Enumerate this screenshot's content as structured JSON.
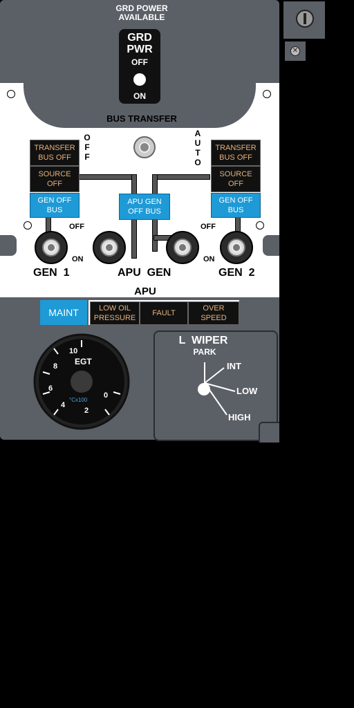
{
  "grd": {
    "available_line1": "GRD POWER",
    "available_line2": "AVAILABLE",
    "switch_line1": "GRD",
    "switch_line2": "PWR",
    "off": "OFF",
    "on": "ON"
  },
  "bus_transfer": {
    "label": "BUS TRANSFER",
    "off_letters": "OFF",
    "auto_letters": "AUTO"
  },
  "left_lamps": {
    "transfer": "TRANSFER\nBUS OFF",
    "source": "SOURCE\nOFF",
    "gen_off": "GEN OFF\nBUS"
  },
  "right_lamps": {
    "transfer": "TRANSFER\nBUS OFF",
    "source": "SOURCE\nOFF",
    "gen_off": "GEN OFF\nBUS"
  },
  "apu_gen_lamp": "APU GEN\nOFF BUS",
  "switch_labels": {
    "off_left": "OFF",
    "on_left": "ON",
    "off_right": "OFF",
    "on_right": "ON"
  },
  "gen_labels": {
    "gen1": "GEN  1",
    "apu_gen": "APU  GEN",
    "gen2": "GEN  2"
  },
  "apu": {
    "title": "APU",
    "maint": "MAINT",
    "low_oil": "LOW OIL\nPRESSURE",
    "fault": "FAULT",
    "overspeed": "OVER\nSPEED"
  },
  "egt": {
    "label": "EGT",
    "unit": "°Cx100",
    "ticks": [
      "10",
      "8",
      "6",
      "4",
      "2",
      "0"
    ]
  },
  "wiper": {
    "title": "L  WIPER",
    "park": "PARK",
    "int": "INT",
    "low": "LOW",
    "high": "HIGH"
  },
  "colors": {
    "panel": "#5b5f66",
    "lamp_amber": "#e8b27a",
    "lamp_blue": "#1e9ad6"
  }
}
